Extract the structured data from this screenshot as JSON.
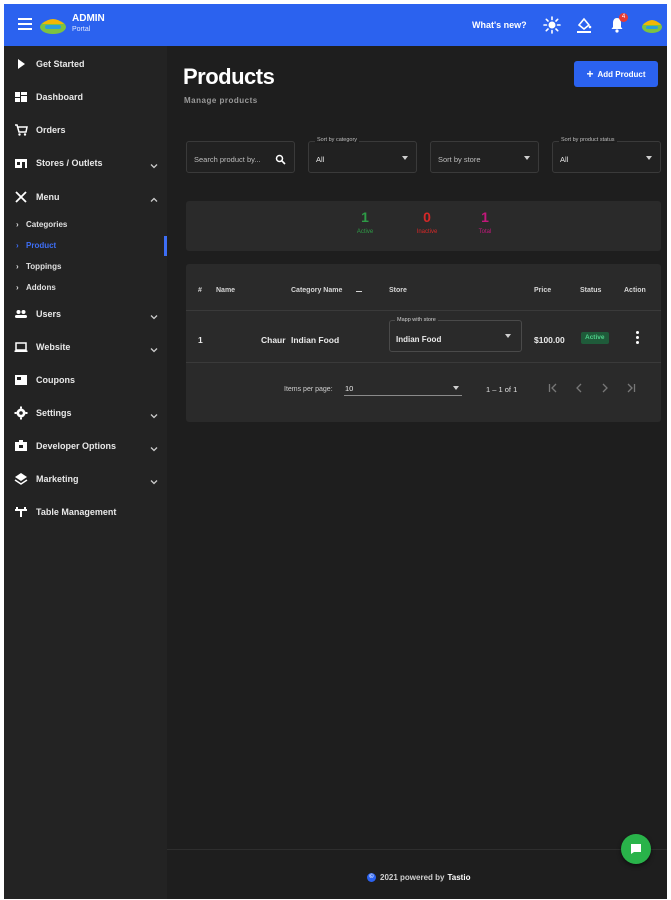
{
  "header": {
    "brand_title": "ADMIN",
    "brand_subtitle": "Portal",
    "whats_new": "What's new?",
    "notification_count": "4"
  },
  "sidebar": {
    "items": [
      {
        "label": "Get Started",
        "icon": "play-icon"
      },
      {
        "label": "Dashboard",
        "icon": "dashboard-icon"
      },
      {
        "label": "Orders",
        "icon": "cart-icon"
      },
      {
        "label": "Stores / Outlets",
        "icon": "store-icon"
      },
      {
        "label": "Menu",
        "icon": "utensils-icon"
      },
      {
        "label": "Users",
        "icon": "users-icon"
      },
      {
        "label": "Website",
        "icon": "laptop-icon"
      },
      {
        "label": "Coupons",
        "icon": "coupon-icon"
      },
      {
        "label": "Settings",
        "icon": "gear-icon"
      },
      {
        "label": "Developer Options",
        "icon": "developer-icon"
      },
      {
        "label": "Marketing",
        "icon": "layers-icon"
      },
      {
        "label": "Table Management",
        "icon": "table-icon"
      }
    ],
    "menu_sub": [
      "Categories",
      "Product",
      "Toppings",
      "Addons"
    ]
  },
  "page": {
    "title": "Products",
    "subtitle": "Manage products",
    "add_button": "Add Product"
  },
  "filters": {
    "search_placeholder": "Search product by...",
    "category_label": "Sort by category",
    "category_value": "All",
    "store_value": "Sort by store",
    "status_label": "Sort by product status",
    "status_value": "All"
  },
  "stats": [
    {
      "value": "1",
      "caption": "Active",
      "color": "#2e9b46"
    },
    {
      "value": "0",
      "caption": "Inactive",
      "color": "#d62828"
    },
    {
      "value": "1",
      "caption": "Total",
      "color": "#c2187b"
    }
  ],
  "table": {
    "headers": [
      "#",
      "Name",
      "Category Name",
      "Store",
      "Price",
      "Status",
      "Action"
    ],
    "rows": [
      {
        "index": "1",
        "name": "Chaur",
        "category": "Indian Food",
        "store_label": "Mapp with store",
        "store": "Indian Food",
        "price": "$100.00",
        "status": "Active"
      }
    ],
    "pagination": {
      "items_per_page_label": "Items per page:",
      "items_per_page": "10",
      "range": "1 – 1 of 1"
    }
  },
  "footer": {
    "copyright": "©",
    "text": "2021 powered by",
    "brand": "Tastio"
  },
  "colors": {
    "accent": "#2b62ef",
    "background": "#1e1e1e",
    "sidebar": "#232323",
    "active_green": "#4fd08a"
  }
}
